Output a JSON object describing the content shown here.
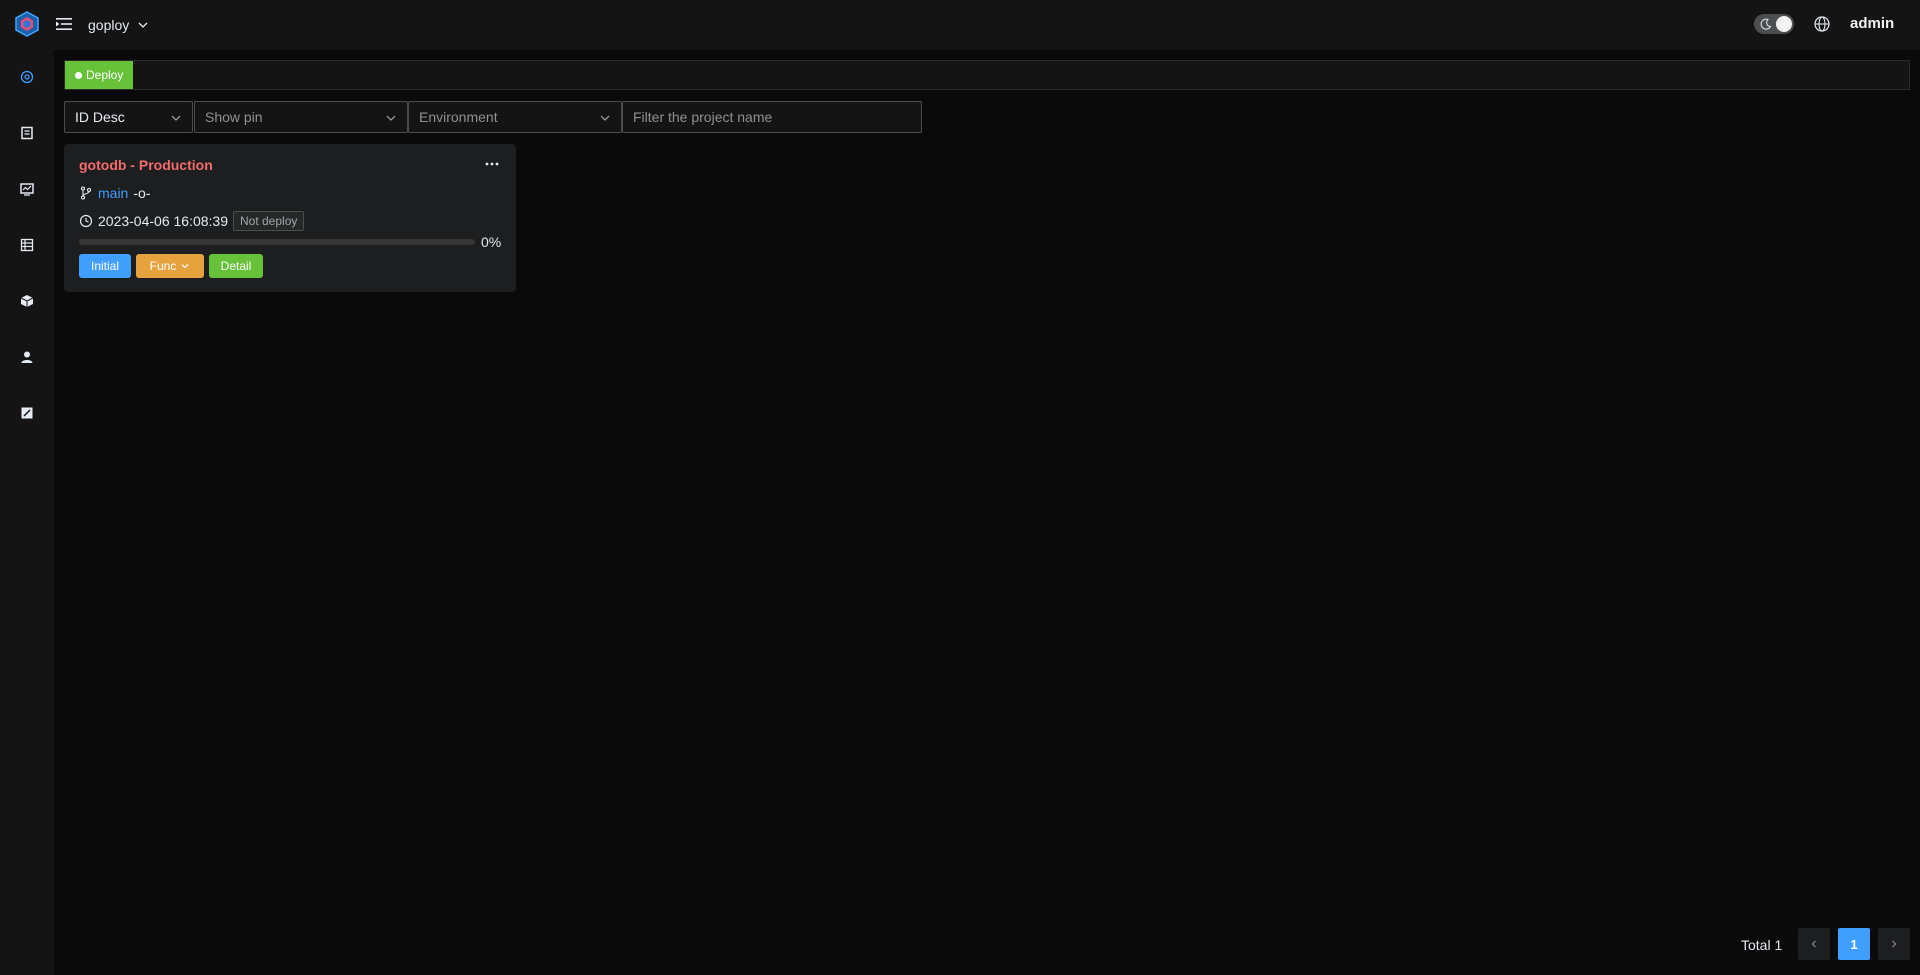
{
  "header": {
    "namespace": "goploy",
    "user": "admin"
  },
  "sidebar": {
    "items": [
      {
        "icon": "deploy-icon",
        "active": true
      },
      {
        "icon": "log-book-icon"
      },
      {
        "icon": "monitor-icon"
      },
      {
        "icon": "server-list-icon"
      },
      {
        "icon": "package-icon"
      },
      {
        "icon": "user-icon"
      },
      {
        "icon": "edit-document-icon"
      }
    ]
  },
  "tabs": [
    {
      "label": "Deploy",
      "active": true
    }
  ],
  "filters": {
    "sort": {
      "value": "ID Desc"
    },
    "pin": {
      "placeholder": "Show pin"
    },
    "environment": {
      "placeholder": "Environment"
    },
    "project_name": {
      "placeholder": "Filter the project name"
    }
  },
  "projects": [
    {
      "title": "gotodb - Production",
      "branch": "main",
      "commit": "-o-",
      "time": "2023-04-06 16:08:39",
      "status": "Not deploy",
      "progress_percent": 0,
      "progress_text": "0%",
      "buttons": {
        "initial": "Initial",
        "func": "Func",
        "detail": "Detail"
      }
    }
  ],
  "pagination": {
    "total_text": "Total 1",
    "current_page": "1"
  },
  "colors": {
    "primary": "#409eff",
    "success": "#67c23a",
    "warning": "#e6a23c",
    "danger": "#f56c6c",
    "background": "#0a0a0a",
    "panel": "#141414"
  }
}
